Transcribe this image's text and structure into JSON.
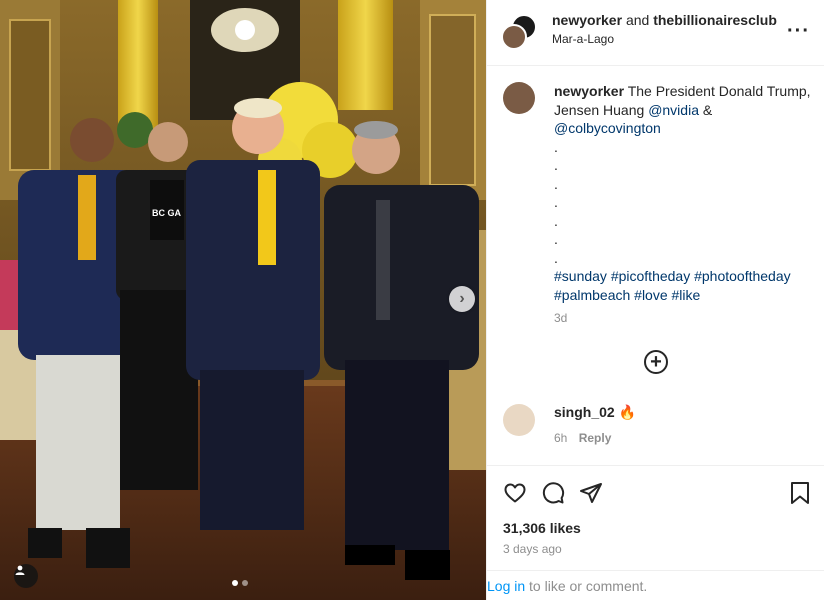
{
  "post": {
    "author": "newyorker",
    "connector": "and",
    "collaborator": "thebillionairesclub",
    "location": "Mar-a-Lago",
    "menu_icon": "more-options-icon"
  },
  "caption": {
    "author": "newyorker",
    "text": "The President Donald Trump, Jensen Huang",
    "mention_1": "@nvidia",
    "amp": "&",
    "mention_2": "@colbycovington",
    "dots": [
      ".",
      ".",
      ".",
      ".",
      ".",
      ".",
      "."
    ],
    "hashtags": "#sunday #picoftheday #photooftheday #palmbeach #love #like",
    "age": "3d"
  },
  "more_comments_icon": "plus-circle-icon",
  "comment": {
    "username": "singh_02",
    "emoji": "🔥",
    "age": "6h",
    "reply_label": "Reply"
  },
  "actions": {
    "like_icon": "heart-icon",
    "comment_icon": "comment-icon",
    "share_icon": "share-icon",
    "save_icon": "bookmark-icon",
    "likes": "31,306 likes",
    "date": "3 days ago"
  },
  "login": {
    "link": "Log in",
    "rest": "to like or comment."
  },
  "carousel": {
    "next_icon": "chevron-right-icon",
    "tag_icon": "user-tag-icon",
    "current_index": 1,
    "total": 2
  },
  "photo": {
    "shirt_text": "BC GA"
  },
  "colors": {
    "link": "#00376b",
    "login": "#0095f6",
    "muted": "#8e8e8e"
  }
}
